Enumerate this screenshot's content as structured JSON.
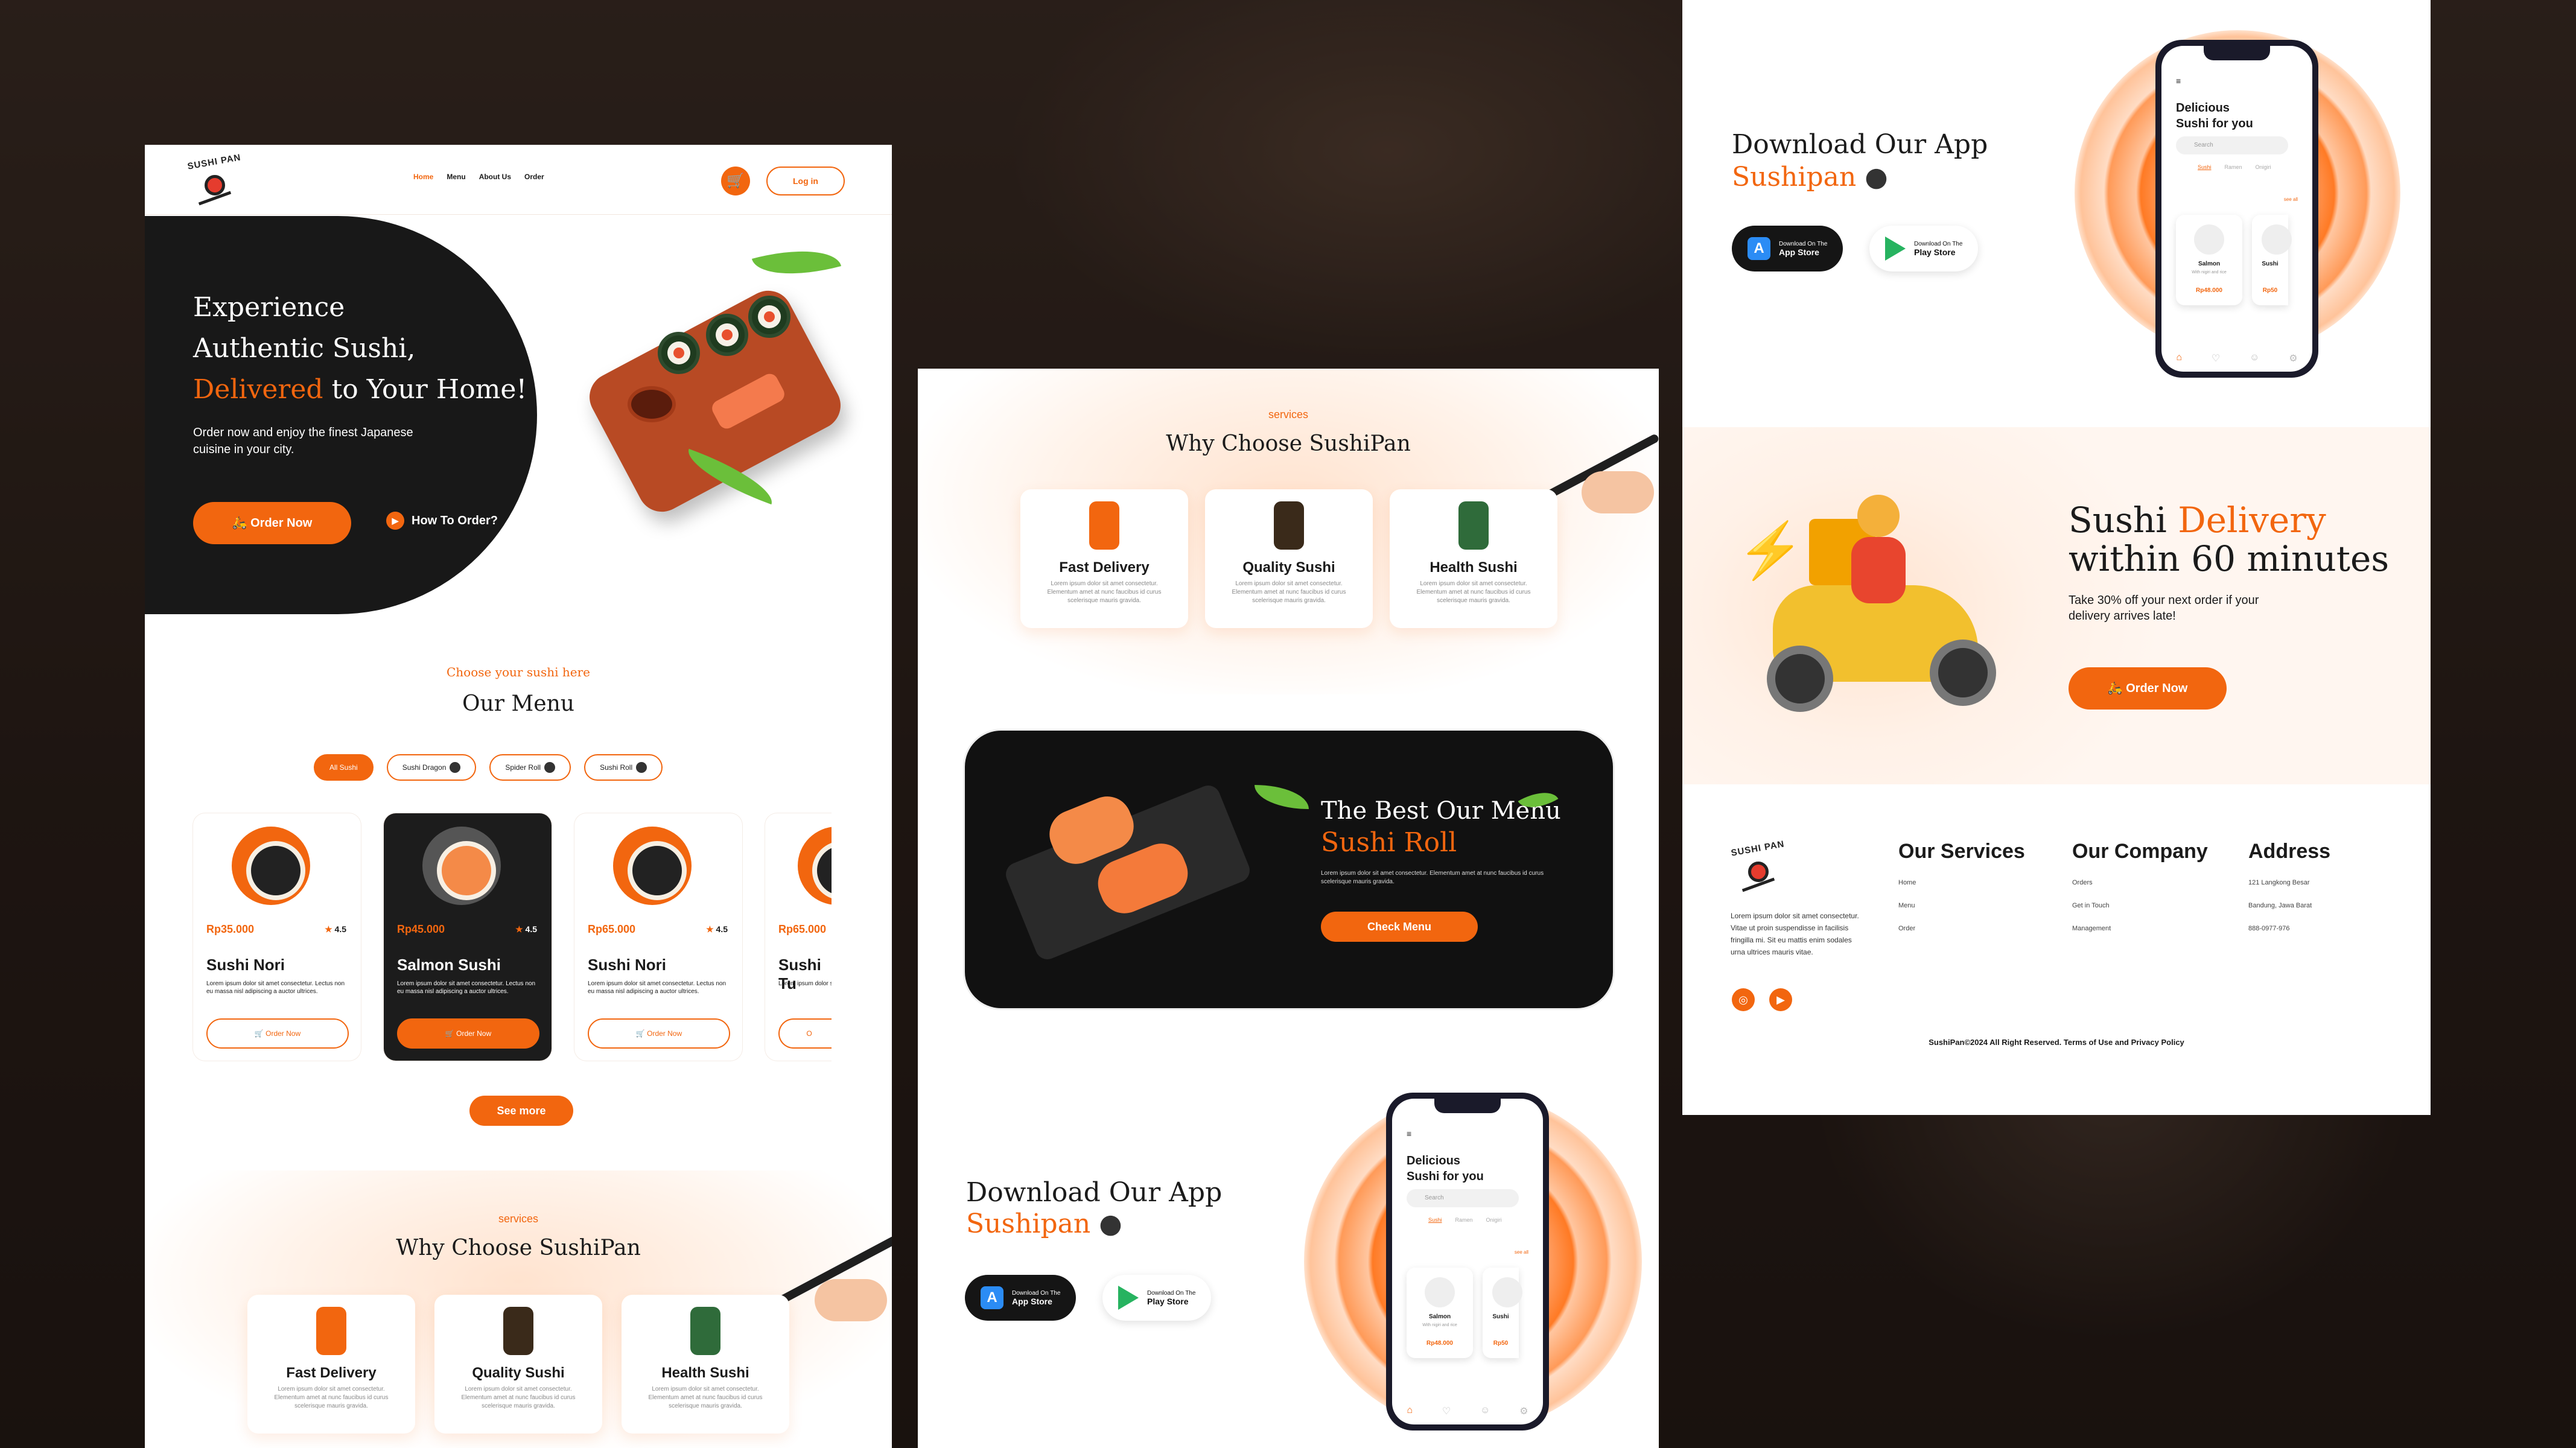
{
  "brand": {
    "logo_text": "SUSHI PAN"
  },
  "nav": {
    "items": [
      "Home",
      "Menu",
      "About Us",
      "Order"
    ],
    "login": "Log in"
  },
  "hero": {
    "line1": "Experience",
    "line2": "Authentic Sushi,",
    "line3a": "Delivered",
    "line3b": " to Your Home!",
    "desc": "Order now and enjoy the finest Japanese cuisine in your city.",
    "order_btn": "Order Now",
    "how_btn": "How To Order?"
  },
  "menu": {
    "eyebrow": "Choose your sushi here",
    "title": "Our Menu",
    "filters": [
      "All Sushi",
      "Sushi Dragon",
      "Spider Roll",
      "Sushi Roll"
    ],
    "cards": [
      {
        "price": "Rp35.000",
        "rating": "4.5",
        "name": "Sushi Nori",
        "desc": "Lorem ipsum dolor sit amet consectetur. Lectus non eu massa nisl adipiscing a auctor ultrices.",
        "btn": "Order Now"
      },
      {
        "price": "Rp45.000",
        "rating": "4.5",
        "name": "Salmon Sushi",
        "desc": "Lorem ipsum dolor sit amet consectetur. Lectus non eu massa nisl adipiscing a auctor ultrices.",
        "btn": "Order Now"
      },
      {
        "price": "Rp65.000",
        "rating": "4.5",
        "name": "Sushi Nori",
        "desc": "Lorem ipsum dolor sit amet consectetur. Lectus non eu massa nisl adipiscing a auctor ultrices.",
        "btn": "Order Now"
      },
      {
        "price": "Rp65.000",
        "rating": "",
        "name": "Sushi Tu",
        "desc": "Lorem ipsum dolor sit a non eu massa nisl adi",
        "btn": "O"
      }
    ],
    "see_more": "See more"
  },
  "why": {
    "eyebrow": "services",
    "title": "Why Choose SushiPan",
    "items": [
      {
        "title": "Fast Delivery",
        "desc": "Lorem ipsum dolor sit amet consectetur. Elementum amet at nunc faucibus id curus scelerisque mauris gravida."
      },
      {
        "title": "Quality Sushi",
        "desc": "Lorem ipsum dolor sit amet consectetur. Elementum amet at nunc faucibus id curus scelerisque mauris gravida."
      },
      {
        "title": "Health Sushi",
        "desc": "Lorem ipsum dolor sit amet consectetur. Elementum amet at nunc faucibus id curus scelerisque mauris gravida."
      }
    ]
  },
  "best": {
    "title1": "The Best Our Menu",
    "title2": "Sushi Roll",
    "desc": "Lorem ipsum dolor sit amet consectetur. Elementum amet at nunc faucibus id curus scelerisque mauris gravida.",
    "btn": "Check Menu"
  },
  "app": {
    "title1": "Download Our App",
    "title2": "Sushipan",
    "appstore_small": "Download On The",
    "appstore": "App Store",
    "play_small": "Download On The",
    "play": "Play Store"
  },
  "phone": {
    "title1": "Delicious",
    "title2": "Sushi for you",
    "search": "Search",
    "tabs": [
      "Sushi",
      "Ramen",
      "Onigiri"
    ],
    "see_all": "see all",
    "card1_name": "Salmon",
    "card1_sub": "With nigiri and rice",
    "card1_price": "Rp48.000",
    "card2_name": "Sushi",
    "card2_sub": "With nigiri",
    "card2_price": "Rp50"
  },
  "delivery": {
    "t1": "Sushi ",
    "t2": "Delivery",
    "t3": "within 60 minutes",
    "desc": "Take 30% off your next order if your delivery arrives late!",
    "btn": "Order Now"
  },
  "footer": {
    "about": "Lorem ipsum dolor sit amet consectetur. Vitae ut proin suspendisse in facilisis fringilla mi. Sit eu mattis enim sodales urna ultrices mauris vitae.",
    "services_title": "Our Services",
    "services": [
      "Home",
      "Menu",
      "Order"
    ],
    "company_title": "Our Company",
    "company": [
      "Orders",
      "Get in Touch",
      "Management"
    ],
    "address_title": "Address",
    "address": [
      "121 Langkong Besar",
      "Bandung, Jawa Barat",
      "888-0977-976"
    ],
    "copyright": "SushiPan©2024 All Right Reserved. Terms of Use and Privacy Policy"
  },
  "colors": {
    "accent": "#f2660f",
    "dark": "#181818"
  }
}
